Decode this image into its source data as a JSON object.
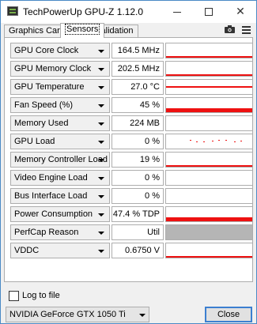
{
  "window": {
    "title": "TechPowerUp GPU-Z 1.12.0",
    "icon": "gpuz-app-icon"
  },
  "tabs": [
    {
      "label": "Graphics Card",
      "active": false
    },
    {
      "label": "Sensors",
      "active": true
    },
    {
      "label": "Validation",
      "active": false
    }
  ],
  "toolbar": {
    "camera_icon": "camera-icon",
    "menu_icon": "hamburger-menu-icon"
  },
  "colors": {
    "graph_fill": "#ee1111",
    "graph_inactive": "#b5b5b5",
    "accent_border": "#3c7fd0"
  },
  "sensors": [
    {
      "name": "GPU Core Clock",
      "value": "164.5 MHz"
    },
    {
      "name": "GPU Memory Clock",
      "value": "202.5 MHz"
    },
    {
      "name": "GPU Temperature",
      "value": "27.0 °C"
    },
    {
      "name": "Fan Speed (%)",
      "value": "45 %"
    },
    {
      "name": "Memory Used",
      "value": "224 MB"
    },
    {
      "name": "GPU Load",
      "value": "0 %"
    },
    {
      "name": "Memory Controller Load",
      "value": "19 %"
    },
    {
      "name": "Video Engine Load",
      "value": "0 %"
    },
    {
      "name": "Bus Interface Load",
      "value": "0 %"
    },
    {
      "name": "Power Consumption",
      "value": "47.4 % TDP"
    },
    {
      "name": "PerfCap Reason",
      "value": "Util"
    },
    {
      "name": "VDDC",
      "value": "0.6750 V"
    }
  ],
  "footer": {
    "log_to_file_label": "Log to file",
    "log_to_file_checked": false,
    "gpu_selected": "NVIDIA GeForce GTX 1050 Ti",
    "close_label": "Close"
  }
}
